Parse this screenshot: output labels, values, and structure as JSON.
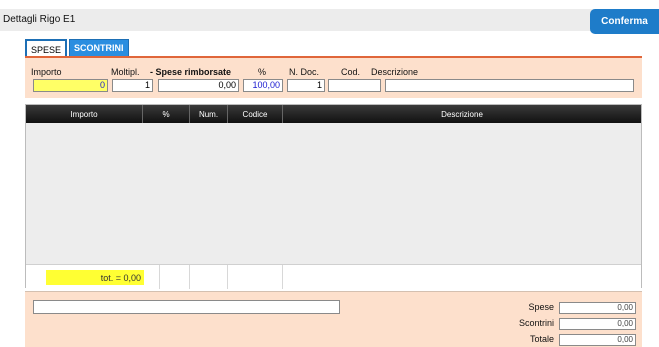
{
  "window": {
    "title": "Dettagli Rigo E1",
    "confirm_label": "Conferma"
  },
  "tabs": [
    {
      "label": "SPESE",
      "active": true
    },
    {
      "label": "SCONTRINI",
      "active": false
    }
  ],
  "header": {
    "labels": {
      "importo": "Importo",
      "moltipl": "Moltipl.",
      "spese_rimborsate": "- Spese rimborsate",
      "percent": "%",
      "n_doc": "N. Doc.",
      "cod": "Cod.",
      "descrizione": "Descrizione"
    },
    "values": {
      "importo": "0",
      "moltipl": "1",
      "spese_rimborsate": "0,00",
      "percent": "100,00",
      "n_doc": "1",
      "cod": "",
      "descrizione": ""
    }
  },
  "grid": {
    "columns": [
      "Importo",
      "%",
      "Num.",
      "Codice",
      "Descrizione"
    ],
    "rows": [],
    "total_label": "tot. = 0,00"
  },
  "summary": {
    "spese_label": "Spese",
    "spese_value": "0,00",
    "scontrini_label": "Scontrini",
    "scontrini_value": "0,00",
    "totale_label": "Totale",
    "totale_value": "0,00"
  },
  "colors": {
    "accent": "#1e7cc9",
    "panel": "#fde0cc",
    "highlight": "#ffff33",
    "tab_border": "#e0663a"
  }
}
